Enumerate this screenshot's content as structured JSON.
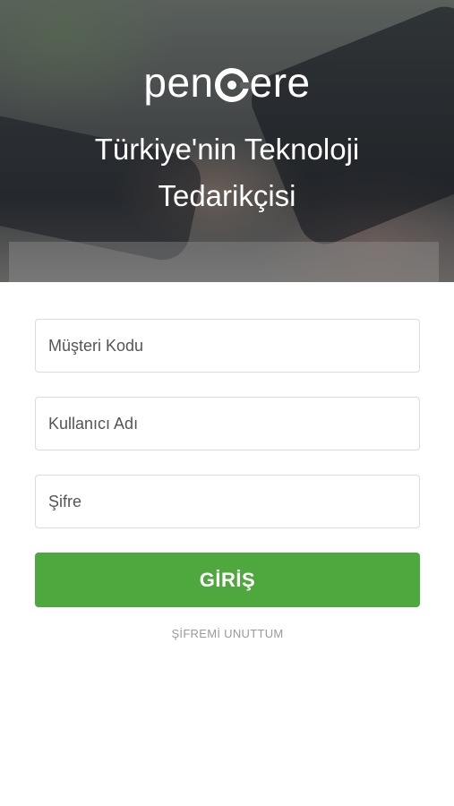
{
  "header": {
    "logo": {
      "part1": "pen",
      "part2": "ere"
    },
    "tagline_line1": "Türkiye'nin Teknoloji",
    "tagline_line2": "Tedarikçisi"
  },
  "login_form": {
    "customer_code_placeholder": "Müşteri Kodu",
    "username_placeholder": "Kullanıcı Adı",
    "password_placeholder": "Şifre",
    "login_label": "GİRİŞ",
    "forgot_password_label": "ŞİFREMİ UNUTTUM"
  },
  "colors": {
    "primary_button": "#4fa83d",
    "forgot_link": "#9a9a9a"
  }
}
